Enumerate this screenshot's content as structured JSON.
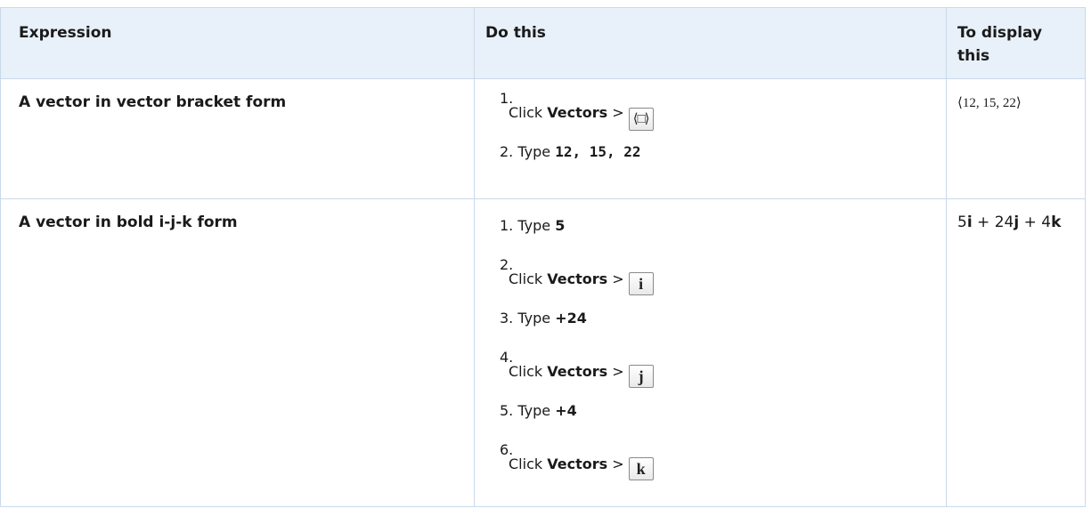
{
  "table": {
    "headers": [
      "Expression",
      "Do this",
      "To display this"
    ],
    "rows": [
      {
        "expression": "A vector in vector bracket form",
        "steps": [
          {
            "num": "1.",
            "action": "Click",
            "target": "Vectors",
            "sep": ">",
            "key_icon": "vector-bracket-key-icon",
            "key_glyph": "⟨□⟩"
          },
          {
            "num": "2.",
            "action": "Type",
            "value": "12, 15, 22"
          }
        ],
        "result": "⟨12, 15, 22⟩"
      },
      {
        "expression": "A vector in bold i-j-k form",
        "steps": [
          {
            "num": "1.",
            "action": "Type",
            "value": "5"
          },
          {
            "num": "2.",
            "action": "Click",
            "target": "Vectors",
            "sep": ">",
            "key_icon": "unit-vector-i-key-icon",
            "key_glyph": "i"
          },
          {
            "num": "3.",
            "action": "Type",
            "value": "+24"
          },
          {
            "num": "4.",
            "action": "Click",
            "target": "Vectors",
            "sep": ">",
            "key_icon": "unit-vector-j-key-icon",
            "key_glyph": "j"
          },
          {
            "num": "5.",
            "action": "Type",
            "value": "+4"
          },
          {
            "num": "6.",
            "action": "Click",
            "target": "Vectors",
            "sep": ">",
            "key_icon": "unit-vector-k-key-icon",
            "key_glyph": "k"
          }
        ],
        "result": {
          "c1": "5",
          "u1": "i",
          "plus1": " + ",
          "c2": "24",
          "u2": "j",
          "plus2": " + ",
          "c3": "4",
          "u3": "k"
        }
      }
    ]
  },
  "colors": {
    "header_bg": "#e8f0f9",
    "border": "#c9d9ea",
    "text": "#1a1a1a"
  }
}
